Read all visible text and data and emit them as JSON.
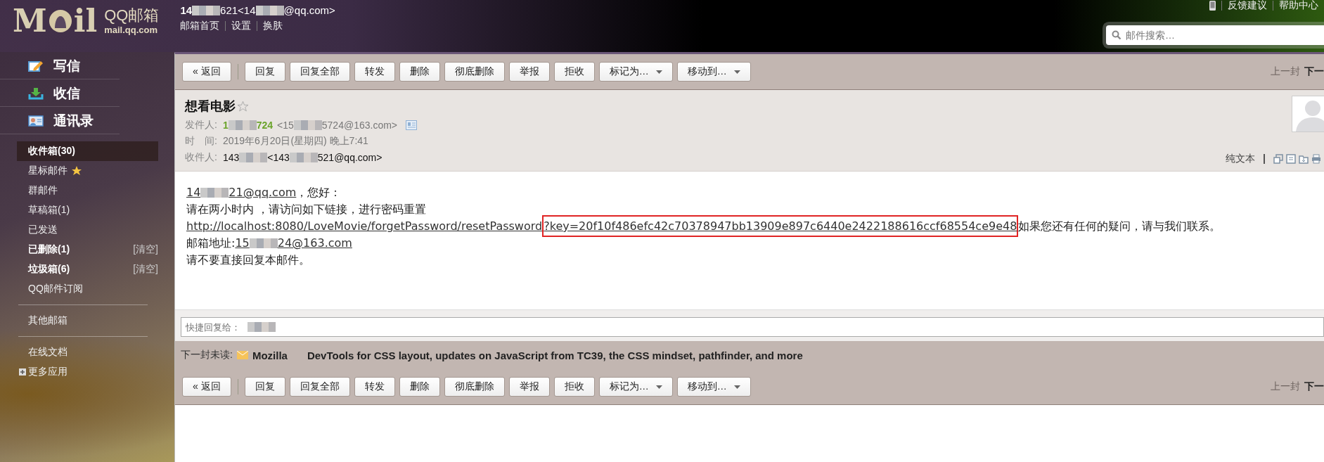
{
  "logo": {
    "left": "M",
    "right": "il",
    "name": "QQ邮箱",
    "url": "mail.qq.com"
  },
  "account": [
    {
      "kind": "text",
      "text": "14"
    },
    {
      "kind": "mosaic"
    },
    {
      "kind": "text",
      "text": "621<14"
    },
    {
      "kind": "mosaic"
    },
    {
      "kind": "text",
      "text": "@qq.com>"
    }
  ],
  "top_links": [
    {
      "text": "邮箱首页"
    },
    {
      "text": "设置"
    },
    {
      "text": "换肤"
    }
  ],
  "utility_links": [
    {
      "text": "反馈建议"
    },
    {
      "text": "帮助中心"
    }
  ],
  "search": {
    "placeholder": "邮件搜索…"
  },
  "actions": [
    {
      "kind": "compose",
      "label": "写信"
    },
    {
      "kind": "inbox",
      "label": "收信"
    },
    {
      "kind": "contacts",
      "label": "通讯录"
    }
  ],
  "folders": [
    {
      "label": "收件箱(30)",
      "selected": true,
      "unread": true
    },
    {
      "label": "星标邮件",
      "selected": false,
      "unread": false,
      "starred": true
    },
    {
      "label": "群邮件",
      "selected": false,
      "unread": false
    },
    {
      "label": "草稿箱(1)",
      "selected": false,
      "unread": false
    },
    {
      "label": "已发送",
      "selected": false,
      "unread": false
    },
    {
      "label": "已删除(1)",
      "selected": false,
      "unread": true,
      "action": "[清空]"
    },
    {
      "label": "垃圾箱(6)",
      "selected": false,
      "unread": true,
      "action": "[清空]"
    },
    {
      "label": "QQ邮件订阅",
      "selected": false,
      "unread": false
    }
  ],
  "other_folders": [
    {
      "label": "其他邮箱"
    }
  ],
  "apps": [
    {
      "label": "在线文档",
      "expandable": false
    },
    {
      "label": "更多应用",
      "expandable": true
    }
  ],
  "toolbars": [
    {
      "back": "« 返回",
      "buttons": [
        {
          "kind": "plain",
          "label": "回复"
        },
        {
          "kind": "plain",
          "label": "回复全部"
        },
        {
          "kind": "plain",
          "label": "转发"
        },
        {
          "kind": "plain",
          "label": "删除"
        },
        {
          "kind": "plain",
          "label": "彻底删除"
        },
        {
          "kind": "plain",
          "label": "举报"
        },
        {
          "kind": "plain",
          "label": "拒收"
        },
        {
          "kind": "dropdown",
          "label": "标记为…"
        },
        {
          "kind": "dropdown",
          "label": "移动到…"
        }
      ],
      "prev": "上一封",
      "next": "下一"
    },
    {
      "back": "« 返回",
      "buttons": [
        {
          "kind": "plain",
          "label": "回复"
        },
        {
          "kind": "plain",
          "label": "回复全部"
        },
        {
          "kind": "plain",
          "label": "转发"
        },
        {
          "kind": "plain",
          "label": "删除"
        },
        {
          "kind": "plain",
          "label": "彻底删除"
        },
        {
          "kind": "plain",
          "label": "举报"
        },
        {
          "kind": "plain",
          "label": "拒收"
        },
        {
          "kind": "dropdown",
          "label": "标记为…"
        },
        {
          "kind": "dropdown",
          "label": "移动到…"
        }
      ],
      "prev": "上一封",
      "next": "下一"
    }
  ],
  "message": {
    "subject": "想看电影",
    "starred": false,
    "from": {
      "label": "发件人:",
      "name": [
        {
          "kind": "text",
          "text": "1"
        },
        {
          "kind": "mosaic"
        },
        {
          "kind": "text",
          "text": "724"
        }
      ],
      "address": [
        {
          "kind": "text",
          "text": "<15"
        },
        {
          "kind": "mosaic"
        },
        {
          "kind": "text",
          "text": "5724@163.com>"
        }
      ]
    },
    "time": {
      "label": "时　间:",
      "value": "2019年6月20日(星期四) 晚上7:41"
    },
    "to": {
      "label": "收件人:",
      "value": [
        {
          "kind": "text",
          "text": "143"
        },
        {
          "kind": "mosaic"
        },
        {
          "kind": "text",
          "text": "<143"
        },
        {
          "kind": "mosaic"
        },
        {
          "kind": "text",
          "text": "521@qq.com>"
        }
      ]
    },
    "plain_text": "纯文本"
  },
  "body": {
    "greeting_address": [
      {
        "kind": "text",
        "text": "14"
      },
      {
        "kind": "mosaic"
      },
      {
        "kind": "text",
        "text": "21@qq.com"
      }
    ],
    "greeting": "，您好：",
    "line_2": "请在两小时内 ，请访问如下链接，进行密码重置",
    "link": "http://localhost:8080/LoveMovie/forgetPassword/resetPassword",
    "link_highlighted": "?key=20f10f486efc42c70378947bb13909e897c6440e2422188616ccf68554ce9e48",
    "link_after": "如果您还有任何的疑问，请与我们联系。",
    "address_label": "邮箱地址: ",
    "address": [
      {
        "kind": "text",
        "text": "15"
      },
      {
        "kind": "mosaic"
      },
      {
        "kind": "text",
        "text": "24@163.com"
      }
    ],
    "line_5": "请不要直接回复本邮件。"
  },
  "quick_reply": {
    "placeholder": "快捷回复给："
  },
  "next_unread": {
    "label": "下一封未读:",
    "sender": "Mozilla",
    "subject": "DevTools for CSS layout, updates on JavaScript from TC39, the CSS mindset, pathfinder, and more"
  }
}
